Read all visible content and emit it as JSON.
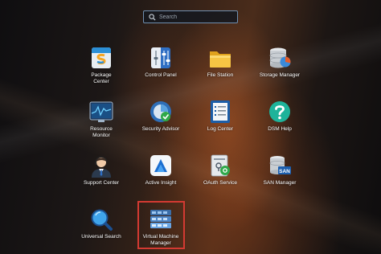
{
  "search": {
    "placeholder": "Search",
    "icon": "search-icon"
  },
  "apps": [
    {
      "id": "package-center",
      "label": "Package\nCenter",
      "icon": "package-center-icon"
    },
    {
      "id": "control-panel",
      "label": "Control Panel",
      "icon": "control-panel-icon"
    },
    {
      "id": "file-station",
      "label": "File Station",
      "icon": "folder-icon"
    },
    {
      "id": "storage-manager",
      "label": "Storage Manager",
      "icon": "storage-manager-icon"
    },
    {
      "id": "resource-monitor",
      "label": "Resource\nMonitor",
      "icon": "resource-monitor-icon"
    },
    {
      "id": "security-advisor",
      "label": "Security Advisor",
      "icon": "security-advisor-icon"
    },
    {
      "id": "log-center",
      "label": "Log Center",
      "icon": "log-center-icon"
    },
    {
      "id": "dsm-help",
      "label": "DSM Help",
      "icon": "help-icon"
    },
    {
      "id": "support-center",
      "label": "Support Center",
      "icon": "support-center-icon"
    },
    {
      "id": "active-insight",
      "label": "Active Insight",
      "icon": "active-insight-icon"
    },
    {
      "id": "oauth-service",
      "label": "OAuth Service",
      "icon": "oauth-service-icon"
    },
    {
      "id": "san-manager",
      "label": "SAN Manager",
      "icon": "san-manager-icon"
    },
    {
      "id": "universal-search",
      "label": "Universal Search",
      "icon": "universal-search-icon"
    },
    {
      "id": "virtual-machine-manager",
      "label": "Virtual Machine\nManager",
      "icon": "virtual-machine-manager-icon",
      "highlighted": true
    }
  ],
  "colors": {
    "highlight_border": "#d33a32",
    "search_border": "#6f8fb0"
  }
}
